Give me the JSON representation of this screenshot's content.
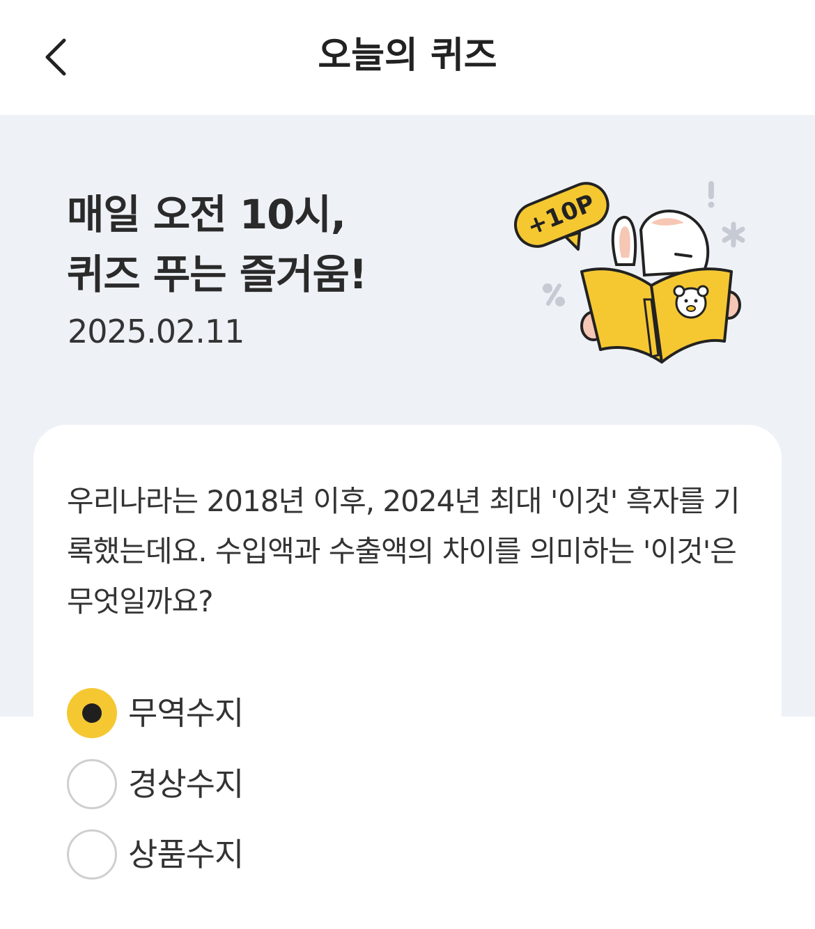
{
  "header": {
    "title": "오늘의 퀴즈",
    "back_icon": "chevron-left-icon"
  },
  "hero": {
    "title_line1": "매일 오전 10시,",
    "title_line2": "퀴즈 푸는 즐거움!",
    "date": "2025.02.11",
    "badge_text": "+10P"
  },
  "quiz": {
    "question": "우리나라는 2018년 이후, 2024년 최대 '이것' 흑자를 기록했는데요. 수입액과 수출액의 차이를 의미하는 '이것'은 무엇일까요?",
    "options": [
      {
        "label": "무역수지",
        "selected": true
      },
      {
        "label": "경상수지",
        "selected": false
      },
      {
        "label": "상품수지",
        "selected": false
      }
    ]
  },
  "colors": {
    "hero_bg": "#eef1f6",
    "accent_yellow": "#f5c832",
    "text_dark": "#2a2a2a"
  }
}
